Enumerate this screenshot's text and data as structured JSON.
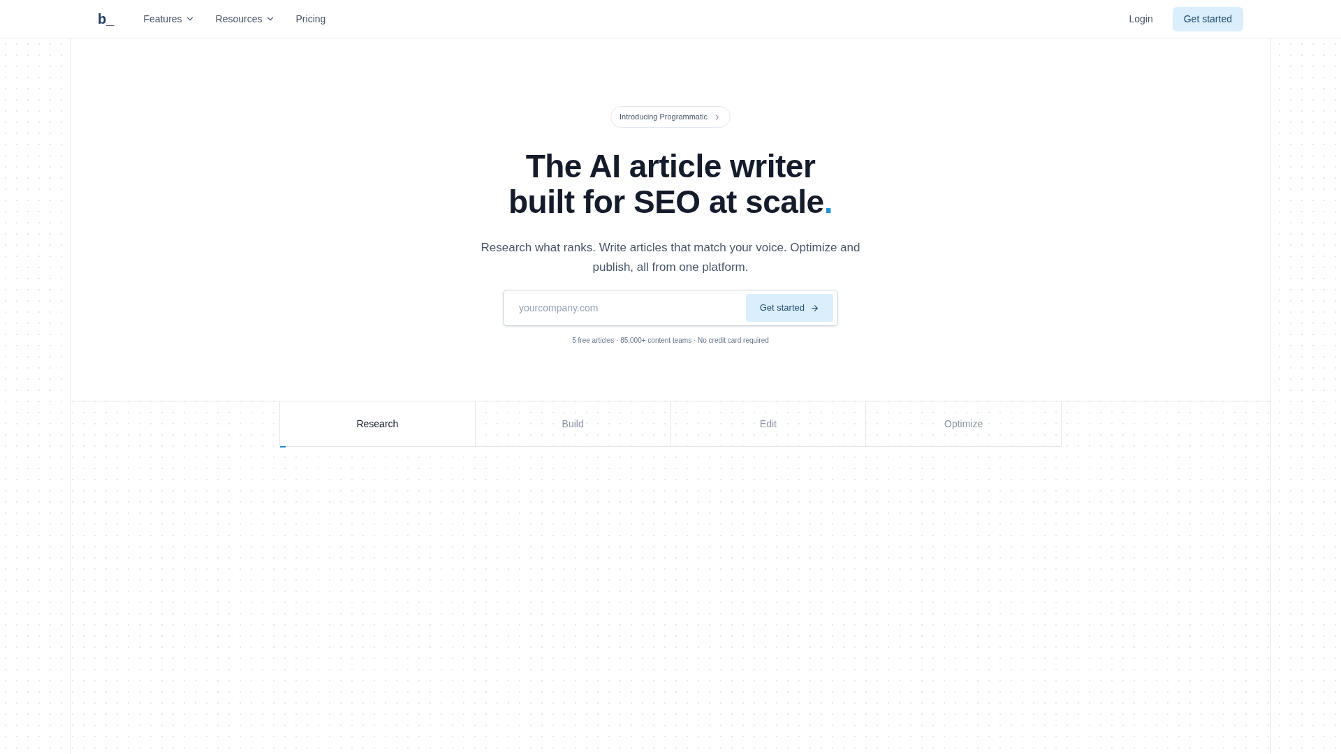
{
  "nav": {
    "logo": "b_",
    "links": [
      {
        "label": "Features",
        "dropdown": true
      },
      {
        "label": "Resources",
        "dropdown": true
      },
      {
        "label": "Pricing",
        "dropdown": false
      }
    ],
    "login": "Login",
    "cta": "Get started"
  },
  "hero": {
    "badge": "Introducing Programmatic",
    "headline": [
      "The AI article writer",
      "built for SEO at scale"
    ],
    "headline_accent": ".",
    "subtitle": "Research what ranks. Write articles that match your voice. Optimize and publish, all from one platform.",
    "input": {
      "placeholder": "yourcompany.com"
    },
    "button": "Get started",
    "note": "5 free articles · 85,000+ content teams · No credit card required"
  },
  "tabs": [
    {
      "label": "Research",
      "selected": true,
      "level": 0.03
    },
    {
      "label": "Build",
      "selected": false
    },
    {
      "label": "Edit",
      "selected": false
    },
    {
      "label": "Optimize",
      "selected": false
    }
  ]
}
